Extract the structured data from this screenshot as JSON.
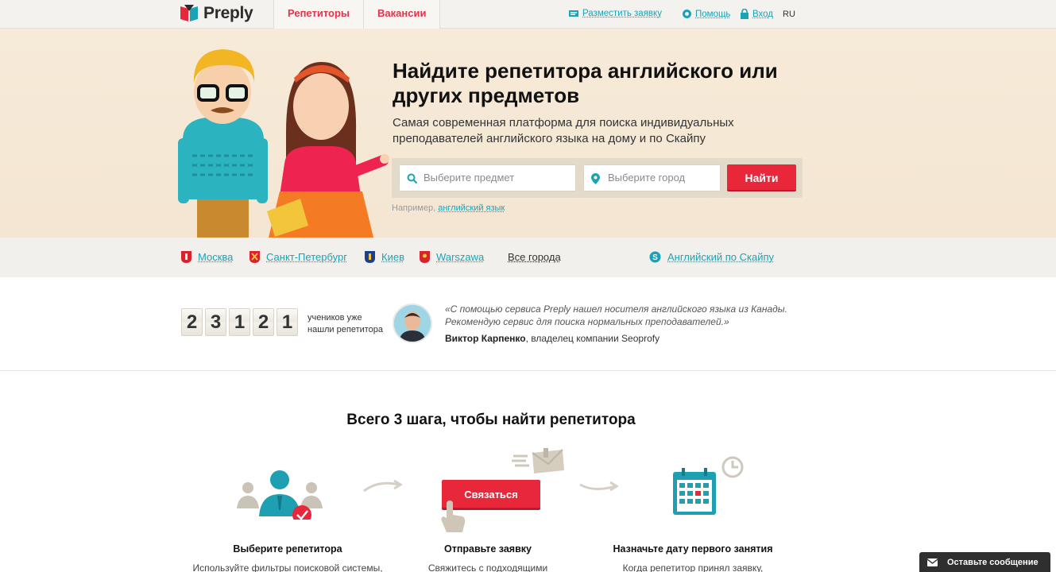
{
  "brand": {
    "name": "Preply",
    "accent": "#e8283a",
    "link": "#1aa3b8"
  },
  "nav": {
    "tabs": [
      "Репетиторы",
      "Вакансии"
    ],
    "post_request": "Разместить заявку",
    "help": "Помощь",
    "login": "Вход",
    "lang": "RU"
  },
  "hero": {
    "title": "Найдите репетитора английского или других предметов",
    "subtitle": "Самая современная платформа для поиска индивидуальных преподавателей английского языка на дому и по Скайпу",
    "subject_placeholder": "Выберите предмет",
    "city_placeholder": "Выберите город",
    "find_button": "Найти",
    "example_prefix": "Например,",
    "example_link": "английский язык"
  },
  "cities": {
    "items": [
      "Москва",
      "Санкт-Петербург",
      "Киев",
      "Warszawa"
    ],
    "all": "Все города",
    "skype": "Английский по Скайпу"
  },
  "stats": {
    "digits": [
      "2",
      "3",
      "1",
      "2",
      "1"
    ],
    "label": "учеников уже нашли репетитора"
  },
  "testimonial": {
    "quote": "«С помощью сервиса Preply нашел носителя английского языка из Канады. Рекомендую сервис для поиска нормальных преподавателей.»",
    "author_name": "Виктор Карпенко",
    "author_role": ", владелец компании Seoprofy"
  },
  "steps": {
    "title": "Всего 3 шага, чтобы найти репетитора",
    "items": [
      {
        "title": "Выберите репетитора",
        "text": "Используйте фильтры поисковой системы,"
      },
      {
        "title": "Отправьте заявку",
        "text": "Свяжитесь с подходящими"
      },
      {
        "title": "Назначьте дату первого занятия",
        "text": "Когда репетитор принял заявку,"
      }
    ],
    "contact_button": "Связаться"
  },
  "chat": {
    "label": "Оставьте сообщение"
  }
}
